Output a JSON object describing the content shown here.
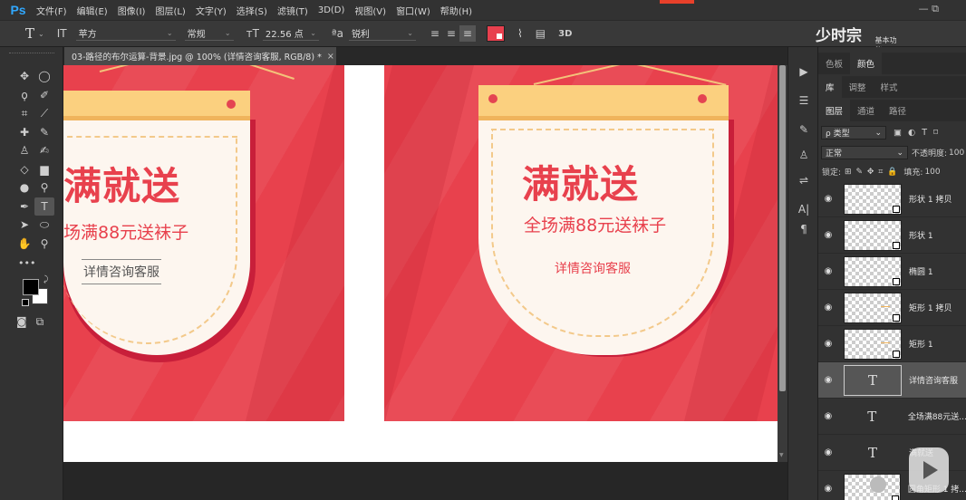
{
  "app": {
    "logo": "Ps",
    "menu": [
      "文件(F)",
      "编辑(E)",
      "图像(I)",
      "图层(L)",
      "文字(Y)",
      "选择(S)",
      "滤镜(T)",
      "3D(D)",
      "视图(V)",
      "窗口(W)",
      "帮助(H)"
    ],
    "window_controls": "— ⧉"
  },
  "options": {
    "tool_glyph": "T",
    "tool_caret": "⌄",
    "orient_glyph": "IT",
    "font_family": "苹方",
    "font_style": "常规",
    "size_glyph": "тT",
    "font_size": "22.56 点",
    "aa_glyph": "ªa",
    "antialias": "锐利",
    "threed_label": "3D",
    "text_color": "#e8404e"
  },
  "watermark": {
    "text": "少时宗悫",
    "small": "基本功能",
    "logo": "bilibili"
  },
  "document": {
    "tab_title": "03-路径的布尔运算-背景.jpg @ 100% (详情咨询客服, RGB/8) *",
    "close": "×"
  },
  "poster_left": {
    "title": "满就送",
    "subtitle": "场满88元送袜子",
    "cs": "详情咨询客服"
  },
  "poster_right": {
    "title": "满就送",
    "subtitle": "全场满88元送袜子",
    "cs": "详情咨询客服"
  },
  "panels": {
    "top_tabs": [
      "色板",
      "颜色"
    ],
    "mid_tabs": [
      "库",
      "调整",
      "样式"
    ],
    "layer_tabs": [
      "图层",
      "通道",
      "路径"
    ],
    "filter_kind": "ρ 类型",
    "blend_mode": "正常",
    "opacity_label": "不透明度:",
    "opacity_value": "100",
    "lock_label": "锁定:",
    "fill_label": "填充:",
    "fill_value": "100",
    "filter_icons": "▣ ◐ T ⌑",
    "lock_icons": "⊞ ✎ ✥ ⌗ 🔒"
  },
  "layers": [
    {
      "name": "形状 1 拷贝",
      "type": "shape"
    },
    {
      "name": "形状 1",
      "type": "shape"
    },
    {
      "name": "椭圆 1",
      "type": "shape"
    },
    {
      "name": "矩形 1 拷贝",
      "type": "shape"
    },
    {
      "name": "矩形 1",
      "type": "shape"
    },
    {
      "name": "详情咨询客服",
      "type": "text",
      "selected": true
    },
    {
      "name": "全场满88元送...",
      "type": "text"
    },
    {
      "name": "满就送",
      "type": "text"
    },
    {
      "name": "圆角矩形 1 拷...",
      "type": "shape"
    }
  ],
  "colors": {
    "poster_red": "#e8414d",
    "tag_cream": "#fdf6ef",
    "tag_yellow": "#fbd07f",
    "ps_blue": "#31a8ff"
  }
}
